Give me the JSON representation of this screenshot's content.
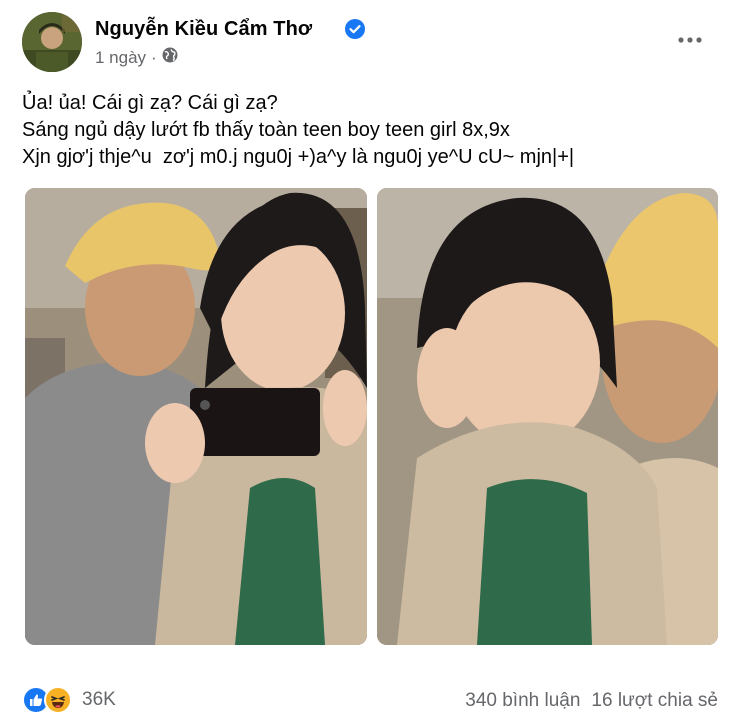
{
  "post": {
    "author": "Nguyễn Kiều Cẩm Thơ",
    "time": "1 ngày",
    "audience_icon": "globe-icon",
    "verified_icon": "verified-badge-icon",
    "more_icon": "more-horizontal-icon",
    "text_lines": [
      "Ủa! ủa! Cái gì zạ? Cái gì zạ?",
      "Sáng ngủ dậy lướt fb thấy toàn teen boy teen girl 8x,9x",
      "Xjn gjơ'j thje^u  zơ'j m0.j ngu0j +)a^y là ngu0j ye^U cU~ mjn|+|"
    ]
  },
  "reactions": {
    "icons": [
      "like-reaction-icon",
      "haha-reaction-icon"
    ],
    "count": "36K"
  },
  "stats": {
    "comments": "340 bình luận",
    "shares": "16 lượt chia sẻ"
  },
  "colors": {
    "accent": "#1877f2",
    "secondary_text": "#65676b",
    "haha": "#f7b125"
  }
}
